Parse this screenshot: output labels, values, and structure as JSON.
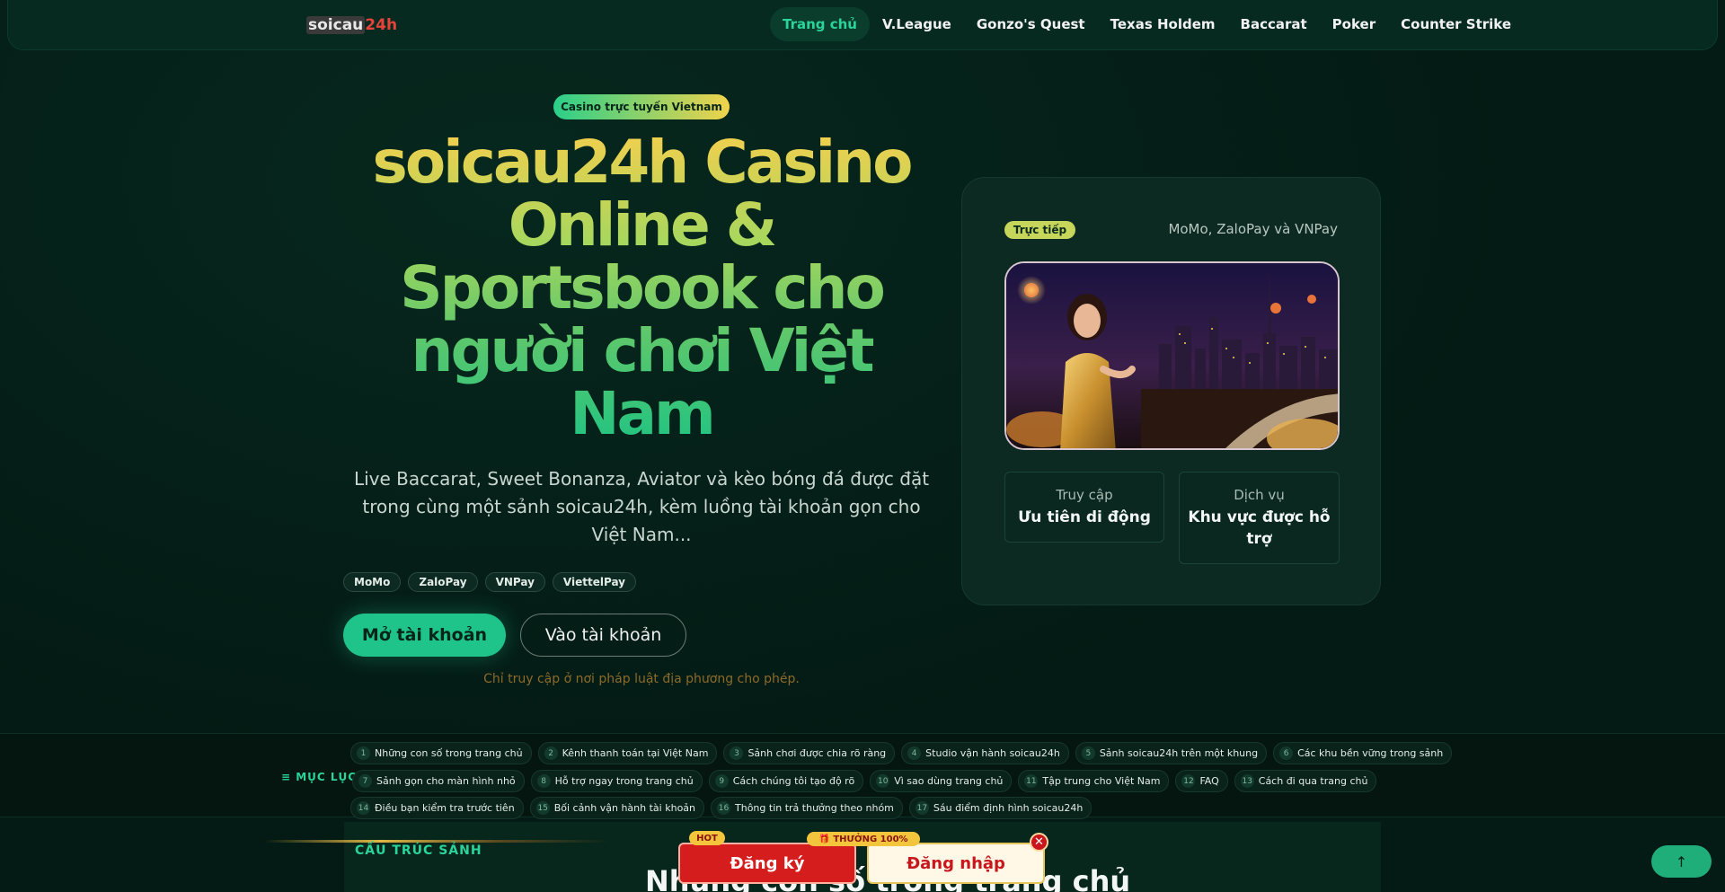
{
  "nav": {
    "logo_part1": "soicau",
    "logo_part2": "24h",
    "links": [
      "Trang chủ",
      "V.League",
      "Gonzo's Quest",
      "Texas Holdem",
      "Baccarat",
      "Poker",
      "Counter Strike"
    ]
  },
  "hero": {
    "badge": "Casino trực tuyến Vietnam",
    "title": "soicau24h Casino Online & Sportsbook cho người chơi Việt Nam",
    "subtitle": "Live Baccarat, Sweet Bonanza, Aviator và kèo bóng đá được đặt trong cùng một sảnh soicau24h, kèm luồng tài khoản gọn cho Việt Nam...",
    "payments": [
      "MoMo",
      "ZaloPay",
      "VNPay",
      "ViettelPay"
    ],
    "primary_cta": "Mở tài khoản",
    "secondary_cta": "Vào tài khoản",
    "legal": "Chỉ truy cập ở nơi pháp luật địa phương cho phép."
  },
  "card": {
    "live_tag": "Trực tiếp",
    "payments_text": "MoMo, ZaloPay và VNPay",
    "box1_label": "Truy cập",
    "box1_value": "Ưu tiên di động",
    "box2_label": "Dịch vụ",
    "box2_value": "Khu vực được hỗ trợ"
  },
  "toc": {
    "label": "MỤC LỤC",
    "row1": [
      {
        "n": "1",
        "t": "Những con số trong trang chủ"
      },
      {
        "n": "2",
        "t": "Kênh thanh toán tại Việt Nam"
      },
      {
        "n": "3",
        "t": "Sảnh chơi được chia rõ ràng"
      },
      {
        "n": "4",
        "t": "Studio vận hành soicau24h"
      },
      {
        "n": "5",
        "t": "Sảnh soicau24h trên một khung"
      },
      {
        "n": "6",
        "t": "Các khu bền vững trong sảnh"
      }
    ],
    "row2": [
      {
        "n": "7",
        "t": "Sảnh gọn cho màn hình nhỏ"
      },
      {
        "n": "8",
        "t": "Hỗ trợ ngay trong trang chủ"
      },
      {
        "n": "9",
        "t": "Cách chúng tôi tạo độ rõ"
      },
      {
        "n": "10",
        "t": "Vì sao dùng trang chủ"
      },
      {
        "n": "11",
        "t": "Tập trung cho Việt Nam"
      },
      {
        "n": "12",
        "t": "FAQ"
      },
      {
        "n": "13",
        "t": "Cách đi qua trang chủ"
      }
    ],
    "row3": [
      {
        "n": "14",
        "t": "Điều bạn kiểm tra trước tiên"
      },
      {
        "n": "15",
        "t": "Bối cảnh vận hành tài khoản"
      },
      {
        "n": "16",
        "t": "Thông tin trả thưởng theo nhóm"
      },
      {
        "n": "17",
        "t": "Sáu điểm định hình soicau24h"
      }
    ]
  },
  "section": {
    "eyebrow": "CẤU TRÚC SẢNH",
    "title": "Những con số trong trang chủ"
  },
  "sticky": {
    "hot": "HOT",
    "bonus": "🎁 THƯỞNG 100%",
    "register": "Đăng ký",
    "login": "Đăng nhập",
    "close": "✕"
  },
  "colors": {
    "accent": "#1fc48a",
    "background": "#041a14",
    "register_red": "#d61d1d",
    "gold": "#f3c53c"
  }
}
